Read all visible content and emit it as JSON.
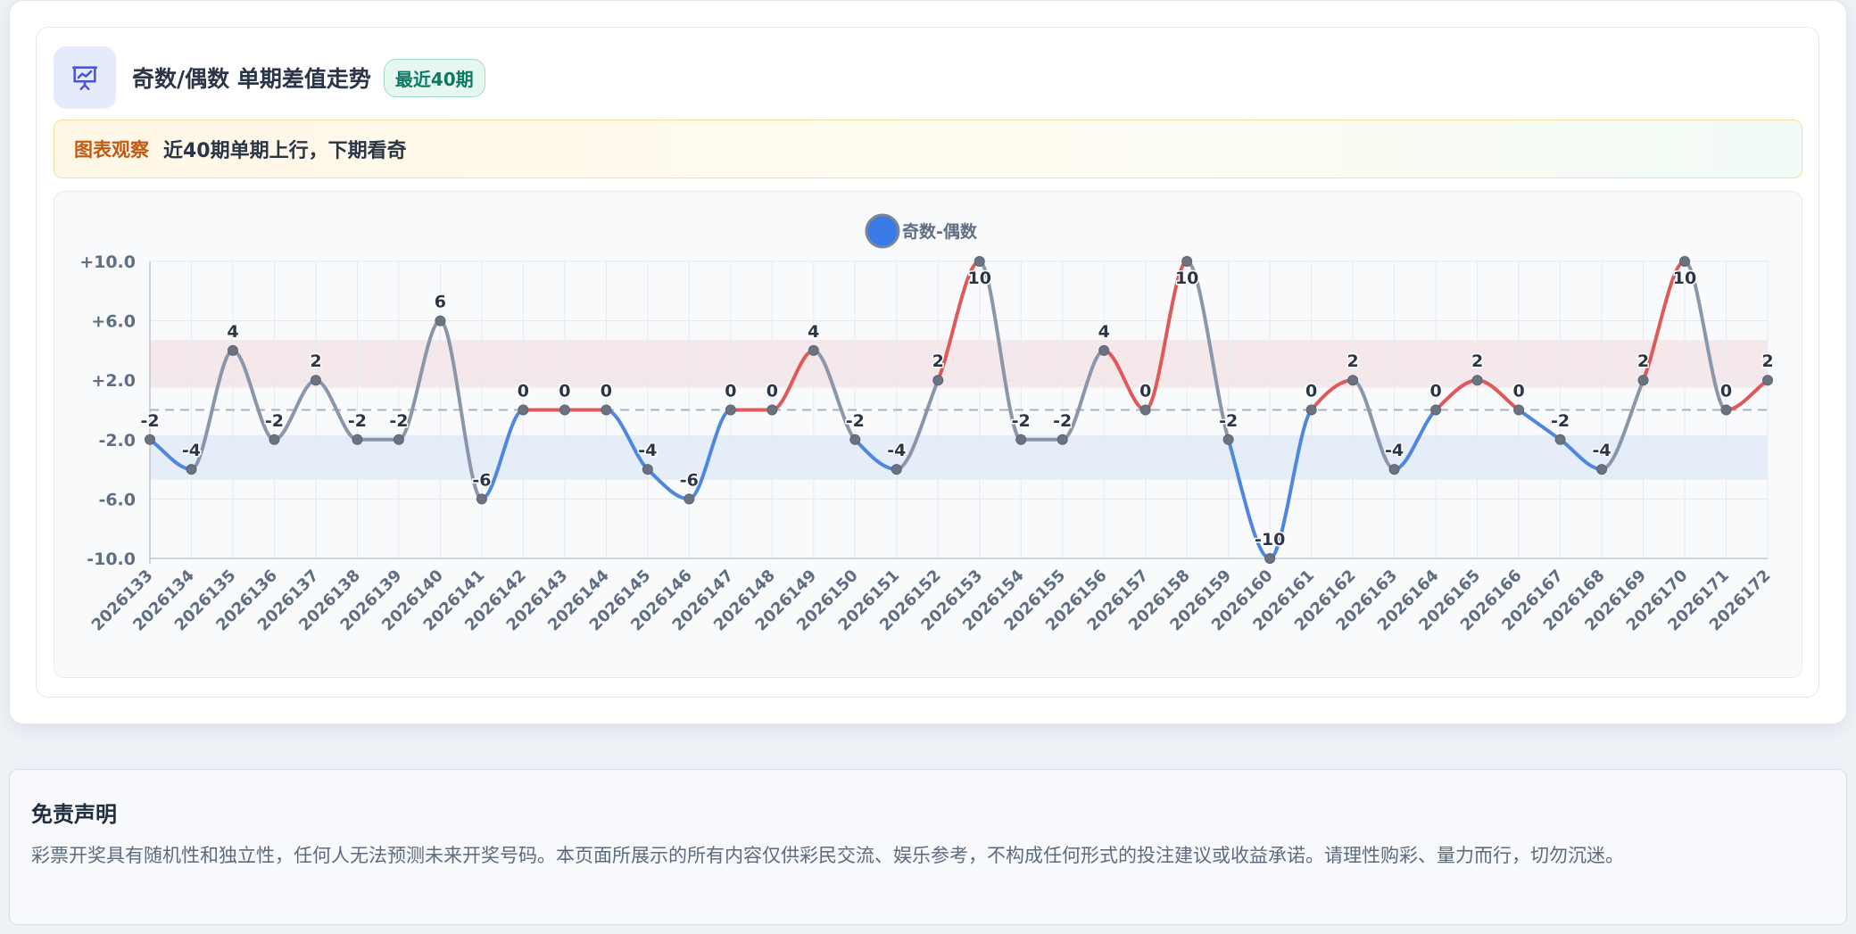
{
  "header": {
    "title": "奇数/偶数 单期差值走势",
    "badge": "最近40期",
    "icon": "presentation-chart-icon"
  },
  "insight": {
    "label": "图表观察",
    "text": "近40期单期上行，下期看奇"
  },
  "disclaimer": {
    "title": "免责声明",
    "text": "彩票开奖具有随机性和独立性，任何人无法预测未来开奖号码。本页面所展示的所有内容仅供彩民交流、娱乐参考，不构成任何形式的投注建议或收益承诺。请理性购彩、量力而行，切勿沉迷。"
  },
  "colors": {
    "accent": "#3b7be8",
    "up": "#e05858",
    "down": "#4f86e0",
    "flat": "#8a96aa",
    "icon": "#4a55d6"
  },
  "chart_data": {
    "type": "line",
    "series": [
      {
        "name": "奇数-偶数",
        "values": [
          -2,
          -4,
          4,
          -2,
          2,
          -2,
          -2,
          6,
          -6,
          0,
          0,
          0,
          -4,
          -6,
          0,
          0,
          4,
          -2,
          -4,
          2,
          10,
          -2,
          -2,
          4,
          0,
          10,
          -2,
          -10,
          0,
          2,
          -4,
          0,
          2,
          0,
          -2,
          -4,
          2,
          10,
          0,
          2
        ]
      }
    ],
    "categories": [
      "2026133",
      "2026134",
      "2026135",
      "2026136",
      "2026137",
      "2026138",
      "2026139",
      "2026140",
      "2026141",
      "2026142",
      "2026143",
      "2026144",
      "2026145",
      "2026146",
      "2026147",
      "2026148",
      "2026149",
      "2026150",
      "2026151",
      "2026152",
      "2026153",
      "2026154",
      "2026155",
      "2026156",
      "2026157",
      "2026158",
      "2026159",
      "2026160",
      "2026161",
      "2026162",
      "2026163",
      "2026164",
      "2026165",
      "2026166",
      "2026167",
      "2026168",
      "2026169",
      "2026170",
      "2026171",
      "2026172"
    ],
    "y_ticks": [
      "+10.0",
      "+6.0",
      "+2.0",
      "-2.0",
      "-6.0",
      "-10.0"
    ],
    "ylim": [
      -10,
      10
    ],
    "bands": [
      {
        "from": 1.5,
        "to": 4.7,
        "color": "#e05858"
      },
      {
        "from": -1.7,
        "to": -4.7,
        "color": "#4f86e0"
      }
    ],
    "reference_line": 0,
    "grid": true,
    "legend_position": "top-center",
    "data_labels": true
  }
}
